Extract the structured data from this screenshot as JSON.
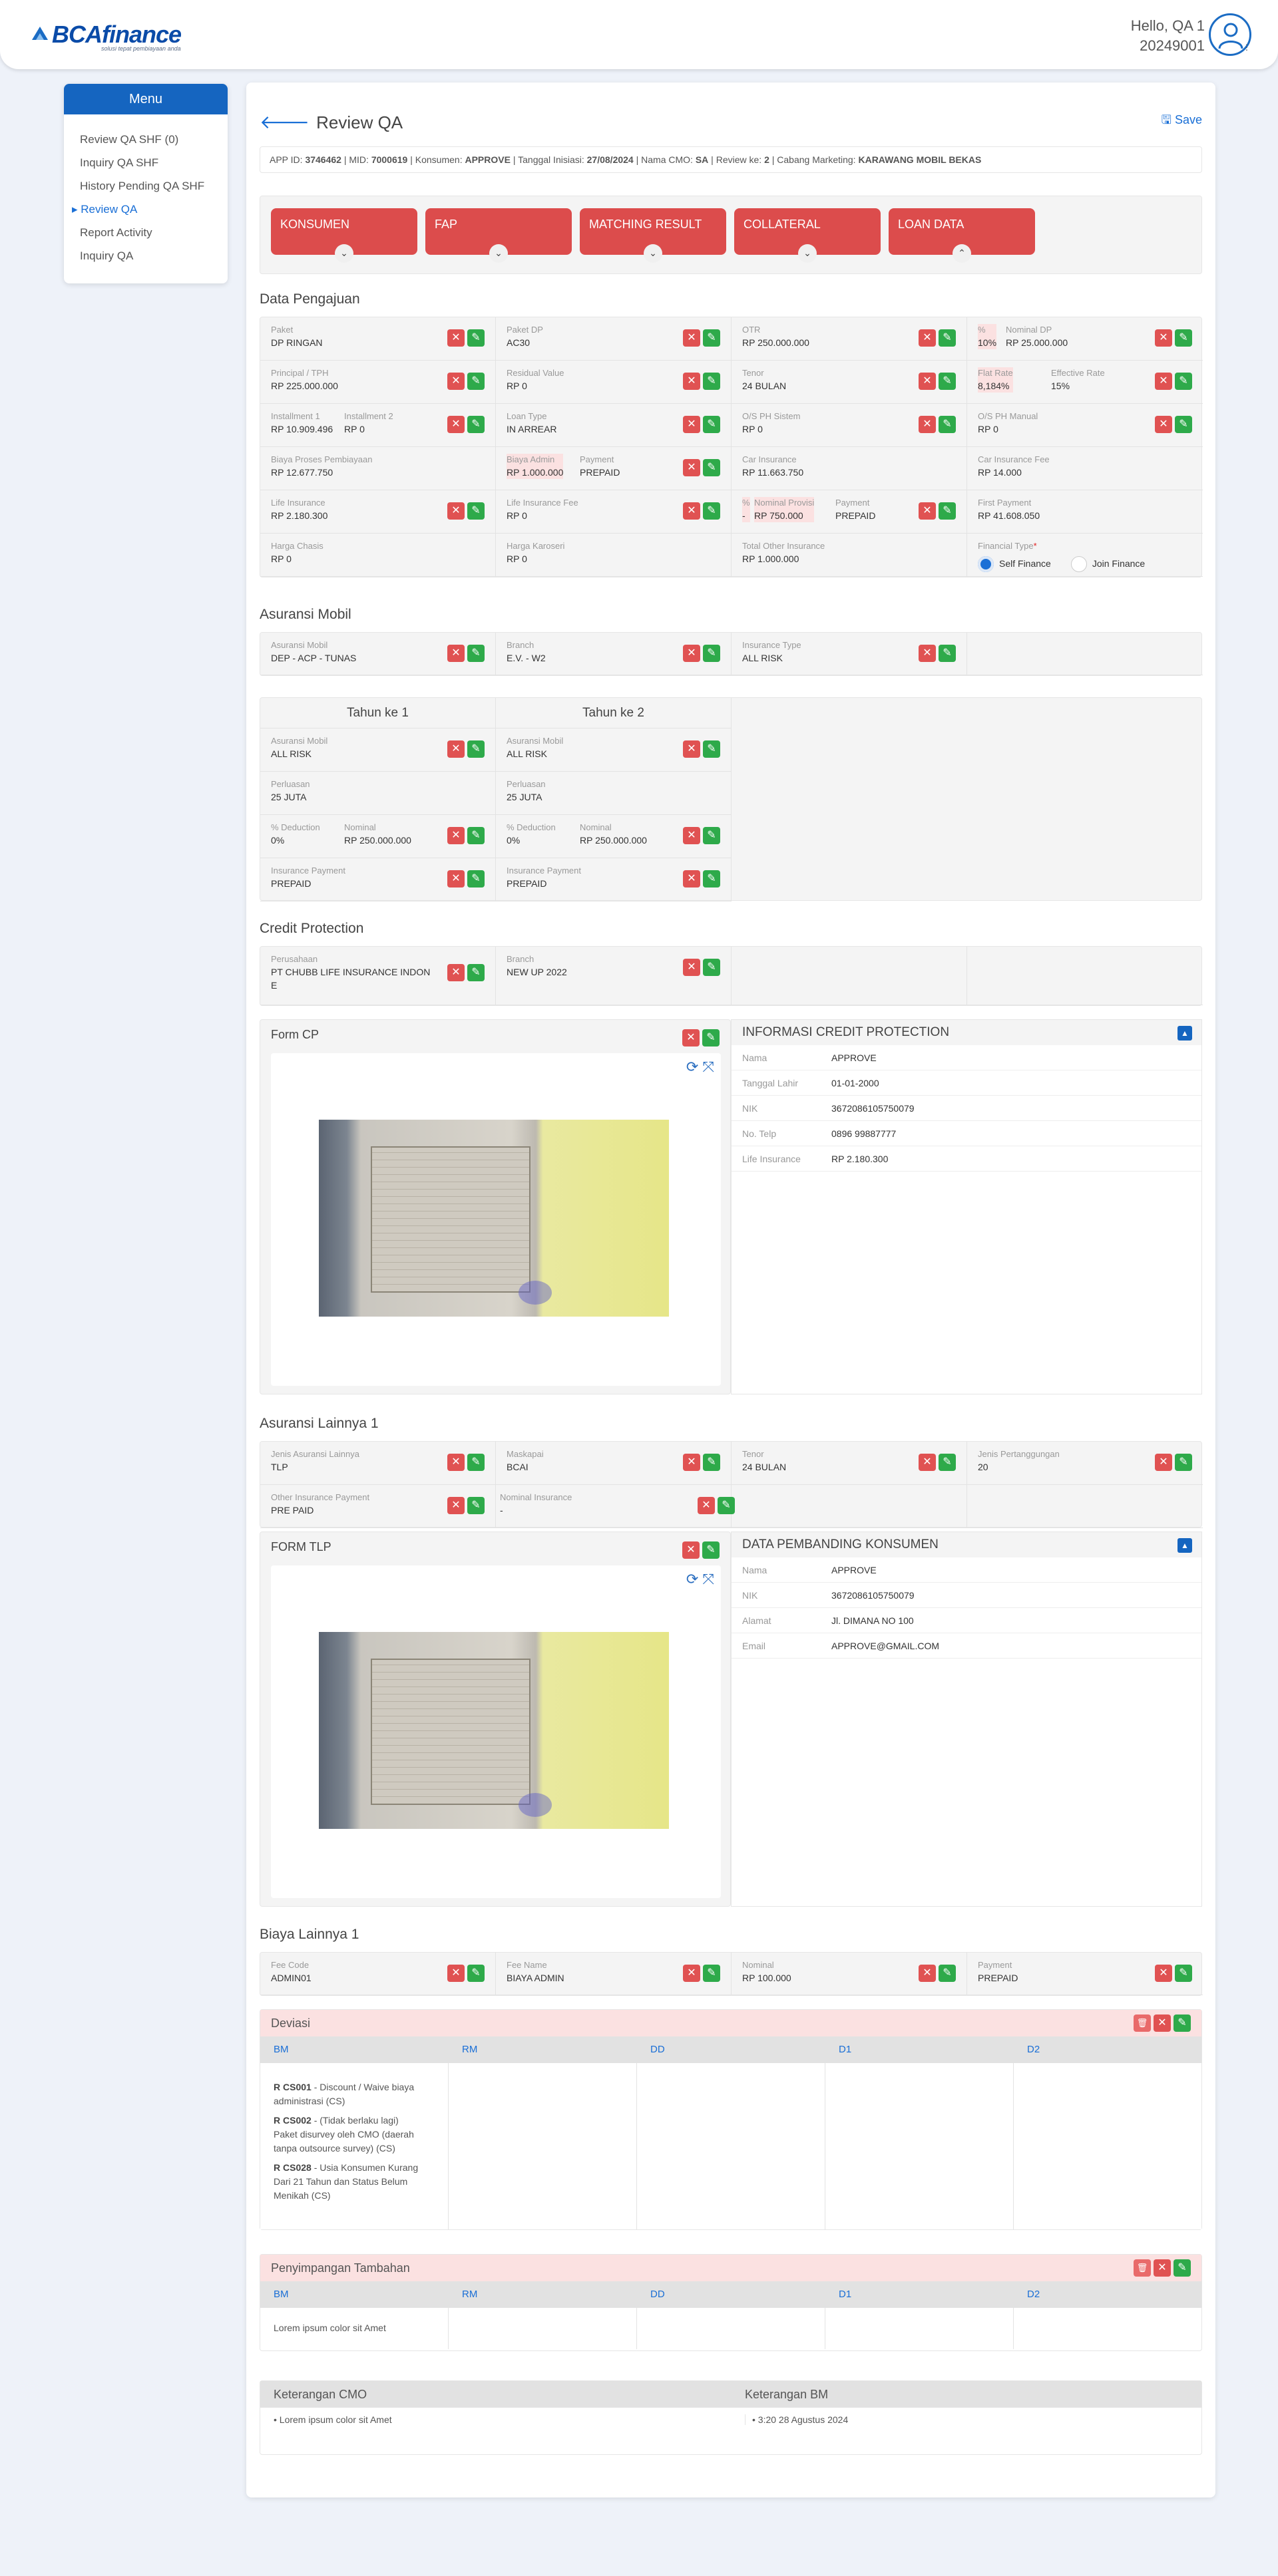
{
  "header": {
    "logo_text": "BCAfinance",
    "logo_tagline": "solusi tepat pembiayaan anda",
    "greeting": "Hello, QA 1",
    "user_id": "20249001"
  },
  "sidebar": {
    "title": "Menu",
    "items": [
      "Review QA SHF (0)",
      "Inquiry QA SHF",
      "History Pending QA SHF",
      "Review QA",
      "Report Activity",
      "Inquiry QA"
    ]
  },
  "page": {
    "title": "Review QA",
    "save_label": "Save",
    "info": {
      "app_id_label": "APP ID:",
      "app_id": "3746462",
      "mid_label": "MID:",
      "mid": "7000619",
      "konsumen_label": "Konsumen:",
      "konsumen": "APPROVE",
      "tanggal_label": "Tanggal Inisiasi:",
      "tanggal": "27/08/2024",
      "cmo_label": "Nama CMO:",
      "cmo": "SA",
      "review_label": "Review ke:",
      "review": "2",
      "cabang_label": "Cabang Marketing:",
      "cabang": "KARAWANG MOBIL BEKAS"
    },
    "tabs": [
      "KONSUMEN",
      "FAP",
      "MATCHING RESULT",
      "COLLATERAL",
      "LOAN DATA"
    ]
  },
  "data_pengajuan": {
    "title": "Data Pengajuan",
    "rows": [
      [
        {
          "l": "Paket",
          "v": "DP RINGAN"
        },
        {
          "l": "Paket DP",
          "v": "AC30"
        },
        {
          "l": "OTR",
          "v": "RP 250.000.000"
        },
        {
          "l2": [
            "%",
            "Nominal DP"
          ],
          "v2": [
            "10%",
            "RP 25.000.000"
          ]
        }
      ],
      [
        {
          "l": "Principal / TPH",
          "v": "RP 225.000.000"
        },
        {
          "l": "Residual Value",
          "v": "RP 0"
        },
        {
          "l": "Tenor",
          "v": "24 BULAN"
        },
        {
          "l2": [
            "Flat Rate",
            "Effective Rate"
          ],
          "v2": [
            "8,184%",
            "15%"
          ]
        }
      ],
      [
        {
          "l2": [
            "Installment 1",
            "Installment 2"
          ],
          "v2": [
            "RP 10.909.496",
            "RP 0"
          ]
        },
        {
          "l": "Loan Type",
          "v": "IN ARREAR"
        },
        {
          "l": "O/S PH Sistem",
          "v": "RP 0"
        },
        {
          "l": "O/S PH Manual",
          "v": "RP 0"
        }
      ],
      [
        {
          "l": "Biaya Proses Pembiayaan",
          "v": "RP 12.677.750"
        },
        {
          "l2": [
            "Biaya Admin",
            "Payment"
          ],
          "v2": [
            "RP 1.000.000",
            "PREPAID"
          ]
        },
        {
          "l": "Car Insurance",
          "v": "RP 11.663.750"
        },
        {
          "l": "Car Insurance Fee",
          "v": "RP 14.000"
        }
      ],
      [
        {
          "l": "Life Insurance",
          "v": "RP 2.180.300"
        },
        {
          "l": "Life Insurance Fee",
          "v": "RP 0"
        },
        {
          "l3": [
            "%",
            "Nominal Provisi",
            "Payment"
          ],
          "v3": [
            "-",
            "RP 750.000",
            "PREPAID"
          ]
        },
        {
          "l": "First Payment",
          "v": "RP 41.608.050"
        }
      ],
      [
        {
          "l": "Harga Chasis",
          "v": "RP 0"
        },
        {
          "l": "Harga Karoseri",
          "v": "RP 0"
        },
        {
          "l": "Total Other Insurance",
          "v": "RP 1.000.000"
        },
        {
          "l": "Financial Type",
          "radio": [
            "Self Finance",
            "Join Finance"
          ]
        }
      ]
    ]
  },
  "asuransi_mobil": {
    "title": "Asuransi Mobil",
    "row": [
      {
        "l": "Asuransi Mobil",
        "v": "DEP - ACP - TUNAS"
      },
      {
        "l": "Branch",
        "v": "E.V. - W2"
      },
      {
        "l": "Insurance Type",
        "v": "ALL RISK"
      }
    ],
    "years": [
      {
        "title": "Tahun ke 1",
        "asuransi": "ALL RISK",
        "perluasan": "25 JUTA",
        "deduction": "0%",
        "nominal": "RP 250.000.000",
        "payment": "PREPAID"
      },
      {
        "title": "Tahun ke 2",
        "asuransi": "ALL RISK",
        "perluasan": "25 JUTA",
        "deduction": "0%",
        "nominal": "RP 250.000.000",
        "payment": "PREPAID"
      }
    ],
    "labels": {
      "asuransi": "Asuransi Mobil",
      "perluasan": "Perluasan",
      "deduction": "% Deduction",
      "nominal": "Nominal",
      "payment": "Insurance Payment"
    }
  },
  "credit_protection": {
    "title": "Credit Protection",
    "perusahaan_label": "Perusahaan",
    "perusahaan_1": "PT CHUBB LIFE INSURANCE INDON",
    "perusahaan_2": "E",
    "branch_label": "Branch",
    "branch": "NEW UP 2022",
    "form_title": "Form CP",
    "info_title": "INFORMASI CREDIT PROTECTION",
    "info": [
      [
        "Nama",
        "APPROVE"
      ],
      [
        "Tanggal Lahir",
        "01-01-2000"
      ],
      [
        "NIK",
        "3672086105750079"
      ],
      [
        "No. Telp",
        "0896 99887777"
      ],
      [
        "Life Insurance",
        "RP 2.180.300"
      ]
    ]
  },
  "asuransi_lainnya": {
    "title": "Asuransi Lainnya 1",
    "row1": [
      {
        "l": "Jenis Asuransi Lainnya",
        "v": "TLP"
      },
      {
        "l": "Maskapai",
        "v": "BCAI"
      },
      {
        "l": "Tenor",
        "v": "24 BULAN"
      },
      {
        "l": "Jenis Pertanggungan",
        "v": "20"
      }
    ],
    "row2": [
      {
        "l": "Other Insurance Payment",
        "v": "PRE PAID"
      },
      {
        "l": "Nominal Insurance",
        "v": "-"
      }
    ],
    "form_title": "FORM TLP",
    "info_title": "DATA PEMBANDING KONSUMEN",
    "info": [
      [
        "Nama",
        "APPROVE"
      ],
      [
        "NIK",
        "3672086105750079"
      ],
      [
        "Alamat",
        "Jl. DIMANA NO 100"
      ],
      [
        "Email",
        "APPROVE@GMAIL.COM"
      ]
    ]
  },
  "biaya_lainnya": {
    "title": "Biaya Lainnya 1",
    "row": [
      {
        "l": "Fee Code",
        "v": "ADMIN01"
      },
      {
        "l": "Fee Name",
        "v": "BIAYA ADMIN"
      },
      {
        "l": "Nominal",
        "v": "RP 100.000"
      },
      {
        "l": "Payment",
        "v": "PREPAID"
      }
    ]
  },
  "deviasi": {
    "title": "Deviasi",
    "columns": [
      "BM",
      "RM",
      "DD",
      "D1",
      "D2"
    ],
    "items": [
      {
        "code": "R CS001",
        "line1": " - Discount / Waive biaya",
        "line2": "administrasi (CS)"
      },
      {
        "code": "R CS002",
        "line1": " - (Tidak berlaku lagi)",
        "line2": "Paket disurvey oleh CMO (daerah",
        "line3": "tanpa outsource survey) (CS)"
      },
      {
        "code": "R CS028",
        "line1": " - Usia Konsumen Kurang",
        "line2": "Dari 21 Tahun dan Status Belum",
        "line3": "Menikah (CS)"
      }
    ]
  },
  "penyimpangan": {
    "title": "Penyimpangan Tambahan",
    "columns": [
      "BM",
      "RM",
      "DD",
      "D1",
      "D2"
    ],
    "text": "Lorem ipsum color sit Amet"
  },
  "keterangan": {
    "cmo_title": "Keterangan CMO",
    "bm_title": "Keterangan BM",
    "cmo_text": "• Lorem ipsum color sit Amet",
    "bm_text": "• 3:20 28 Agustus 2024"
  },
  "colors": {
    "primary": "#1565c0",
    "tab_red": "#dc4c4c",
    "reject": "#e05252",
    "approve": "#2eaa4a",
    "highlight": "#fbe1e1"
  },
  "icons": {
    "back": "arrow-left-icon",
    "save": "save-icon",
    "reject": "close-icon",
    "approve": "pencil-icon",
    "rotate": "rotate-icon",
    "expand": "expand-icon"
  }
}
